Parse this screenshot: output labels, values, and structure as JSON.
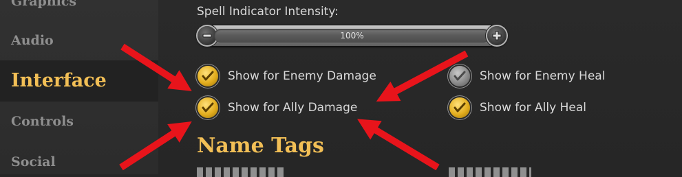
{
  "sidebar": {
    "items": [
      {
        "label": "Graphics"
      },
      {
        "label": "Audio"
      },
      {
        "label": "Interface"
      },
      {
        "label": "Controls"
      },
      {
        "label": "Social"
      }
    ]
  },
  "main": {
    "slider": {
      "label": "Spell Indicator Intensity:",
      "value": "100%",
      "level": 1.0
    },
    "options": [
      {
        "label": "Show for Enemy Damage",
        "checked": true
      },
      {
        "label": "Show for Ally Damage",
        "checked": true
      },
      {
        "label": "Show for Enemy Heal",
        "checked": false
      },
      {
        "label": "Show for Ally Heal",
        "checked": true
      }
    ],
    "section_title": "Name Tags"
  },
  "colors": {
    "accent": "#f2bf56",
    "annotation": "#e8141b",
    "text": "#d9d9d9",
    "muted": "#8f8f8f"
  },
  "icons": {
    "minus": "minus-icon",
    "plus": "plus-icon",
    "check": "check-icon"
  }
}
